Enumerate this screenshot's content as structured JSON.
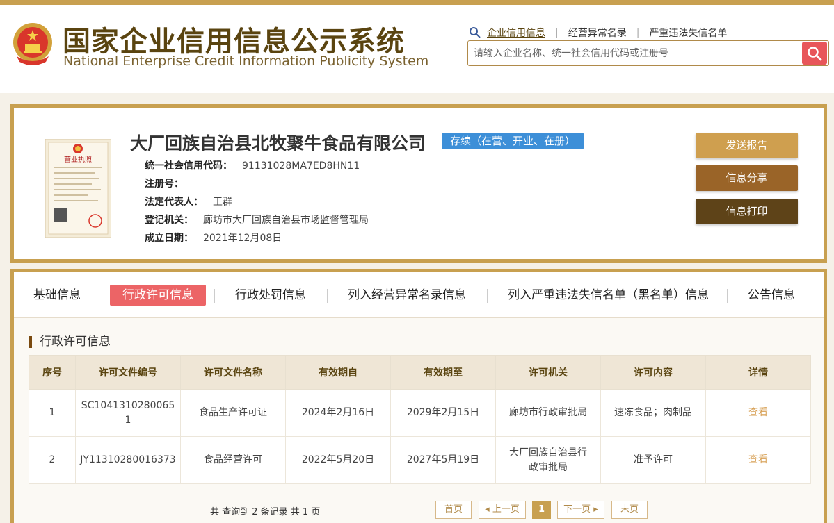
{
  "header": {
    "title_cn": "国家企业信用信息公示系统",
    "title_en": "National Enterprise Credit Information Publicity System",
    "links": [
      "企业信用信息",
      "经营异常名录",
      "严重违法失信名单"
    ],
    "search_placeholder": "请输入企业名称、统一社会信用代码或注册号"
  },
  "company": {
    "name": "大厂回族自治县北牧聚牛食品有限公司",
    "status": "存续（在营、开业、在册）",
    "license_text": "营业执照",
    "fields": [
      {
        "label": "统一社会信用代码：",
        "value": "91131028MA7ED8HN11"
      },
      {
        "label": "注册号：",
        "value": ""
      },
      {
        "label": "法定代表人：",
        "value": "王群"
      },
      {
        "label": "登记机关：",
        "value": "廊坊市大厂回族自治县市场监督管理局"
      },
      {
        "label": "成立日期：",
        "value": "2021年12月08日"
      }
    ],
    "actions": {
      "send": "发送报告",
      "share": "信息分享",
      "print": "信息打印"
    }
  },
  "tabs": [
    "基础信息",
    "行政许可信息",
    "行政处罚信息",
    "列入经营异常名录信息",
    "列入严重违法失信名单（黑名单）信息",
    "公告信息"
  ],
  "section_title": "行政许可信息",
  "table": {
    "headers": [
      "序号",
      "许可文件编号",
      "许可文件名称",
      "有效期自",
      "有效期至",
      "许可机关",
      "许可内容",
      "详情"
    ],
    "rows": [
      [
        "1",
        "SC10413102800651",
        "食品生产许可证",
        "2024年2月16日",
        "2029年2月15日",
        "廊坊市行政审批局",
        "速冻食品；肉制品",
        "查看"
      ],
      [
        "2",
        "JY11310280016373",
        "食品经营许可",
        "2022年5月20日",
        "2027年5月19日",
        "大厂回族自治县行政审批局",
        "准予许可",
        "查看"
      ]
    ]
  },
  "pagination": {
    "summary": "共 查询到 2 条记录 共 1 页",
    "first": "首页",
    "prev": "上一页",
    "current": "1",
    "next": "下一页",
    "last": "末页"
  },
  "colors": {
    "gold": "#c8a050",
    "red": "#ec6466",
    "blue": "#3d8fd8",
    "brown": "#9a6428",
    "dark": "#5e4318"
  }
}
